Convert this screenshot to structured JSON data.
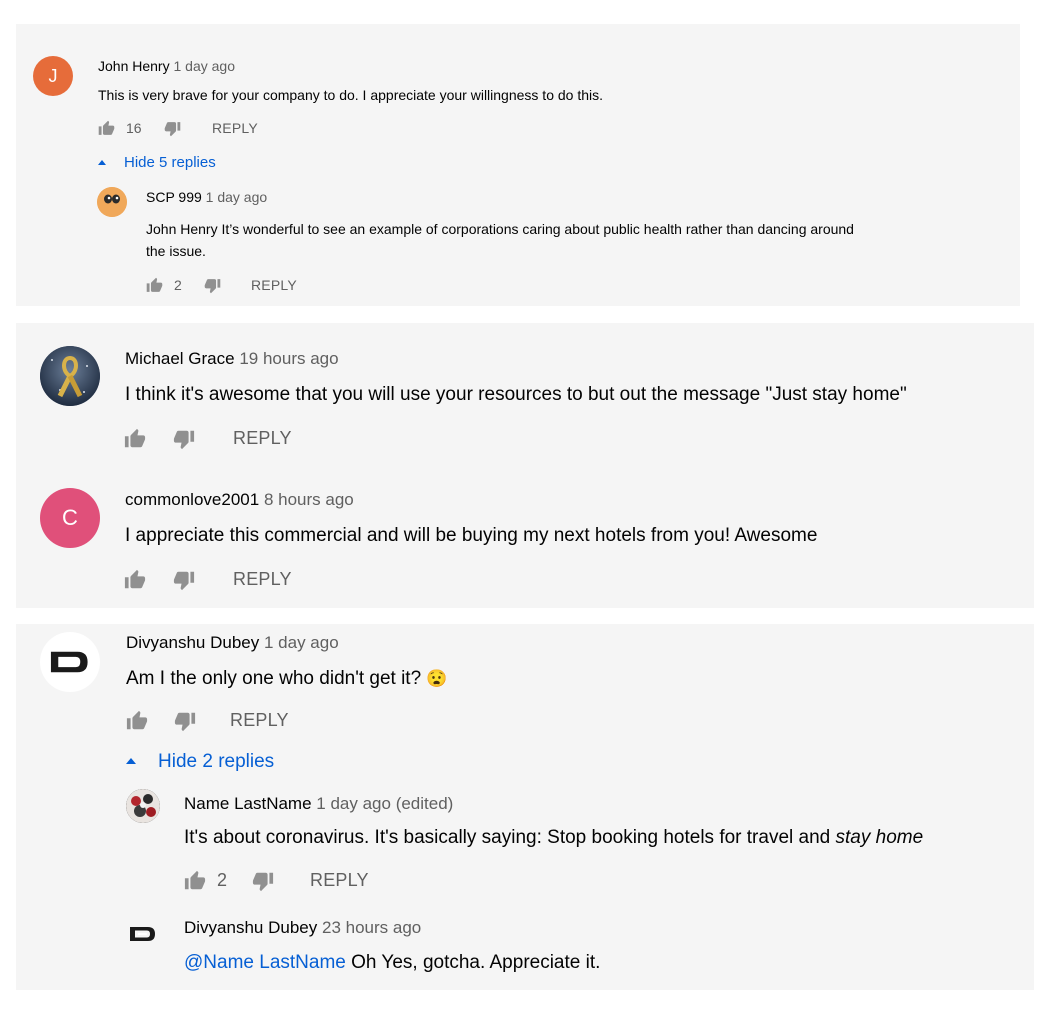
{
  "thread1": {
    "comment": {
      "author": "John Henry",
      "time": "1 day ago",
      "avatar_letter": "J",
      "text": "This is very brave for your company to do. I appreciate your willingness to do this.",
      "likes": "16",
      "reply_label": "REPLY"
    },
    "hide_replies": "Hide 5 replies",
    "replies": [
      {
        "author": "SCP 999",
        "time": "1 day ago",
        "text_line1": "John Henry It’s wonderful to see an example of corporations caring about public health rather than dancing around",
        "text_line2": "the issue.",
        "likes": "2",
        "reply_label": "REPLY"
      }
    ]
  },
  "thread2": {
    "comment": {
      "author": "Michael Grace",
      "time": "19 hours ago",
      "text": "I think it's awesome that you will use your resources to but out the message \"Just stay home\"",
      "reply_label": "REPLY"
    }
  },
  "thread3": {
    "comment": {
      "author": "commonlove2001",
      "time": "8 hours ago",
      "avatar_letter": "C",
      "text": "I appreciate this commercial and will be buying my next hotels from you!  Awesome",
      "reply_label": "REPLY"
    }
  },
  "thread4": {
    "comment": {
      "author": "Divyanshu Dubey",
      "time": "1 day ago",
      "text": "Am I the only one who didn't get it?",
      "emoji": "😧",
      "reply_label": "REPLY"
    },
    "hide_replies": "Hide 2 replies",
    "replies": [
      {
        "author": "Name LastName",
        "time": "1 day ago (edited)",
        "text_plain": "It's about coronavirus. It's basically saying: Stop booking hotels for travel and ",
        "text_italic": "stay home",
        "likes": "2",
        "reply_label": "REPLY"
      },
      {
        "author": "Divyanshu Dubey",
        "time": "23 hours ago",
        "mention": "@Name LastName",
        "text": " Oh Yes, gotcha. Appreciate it."
      }
    ]
  },
  "colors": {
    "panel": "#f5f5f5",
    "link_blue": "#065fd4",
    "meta_gray": "#606060",
    "avatar_orange": "#e66c3a",
    "avatar_pink": "#e0507a"
  }
}
